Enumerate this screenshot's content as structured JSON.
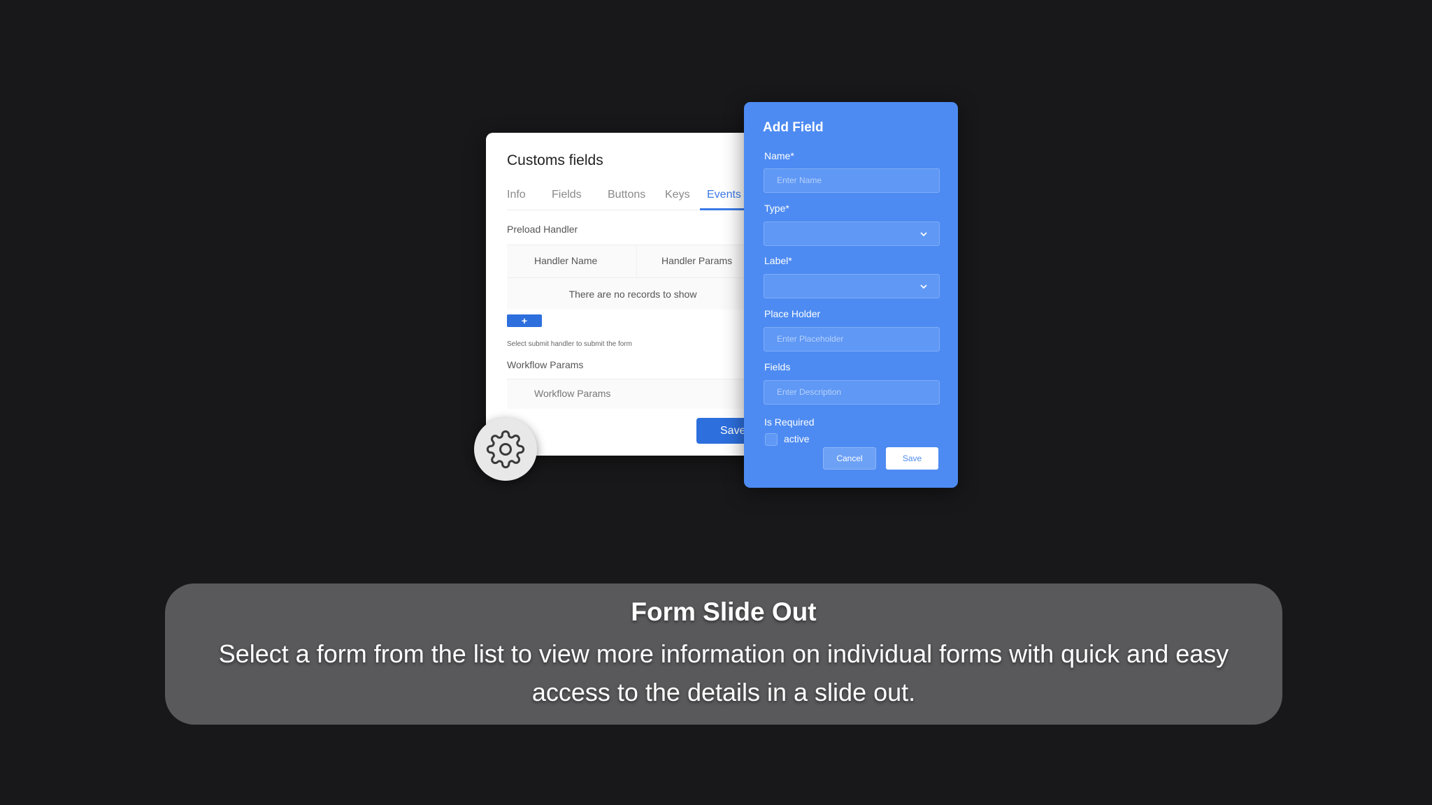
{
  "customs_card": {
    "title": "Customs fields",
    "tabs": [
      {
        "label": "Info"
      },
      {
        "label": "Fields"
      },
      {
        "label": "Buttons"
      },
      {
        "label": "Keys"
      },
      {
        "label": "Events",
        "active": true
      }
    ],
    "preload_label": "Preload Handler",
    "table_headers": [
      "Handler Name",
      "Handler Params"
    ],
    "empty_text": "There are no records to show",
    "add_button": "+",
    "hint": "Select submit handler to submit the form",
    "workflow_label": "Workflow Params",
    "workflow_header": "Workflow Params",
    "save_button": "Save"
  },
  "gear_badge": {
    "icon": "gear-icon"
  },
  "add_field": {
    "title": "Add Field",
    "name_label": "Name*",
    "name_placeholder": "Enter Name",
    "type_label": "Type*",
    "label_label": "Label*",
    "placeholder_label": "Place Holder",
    "placeholder_placeholder": "Enter Placeholder",
    "fields_label": "Fields",
    "fields_placeholder": "Enter Description",
    "required_label": "Is Required",
    "active_label": "active",
    "active_checked": false,
    "cancel_button": "Cancel",
    "save_button": "Save",
    "accent_color": "#4d8bf2"
  },
  "caption": {
    "title": "Form Slide Out",
    "body": "Select a form from the list to view more information on individual forms with quick and easy access to the details in a slide out."
  },
  "colors": {
    "background": "#18181a",
    "primary_blue": "#2d6fdd",
    "caption_bg": "#59595b"
  }
}
